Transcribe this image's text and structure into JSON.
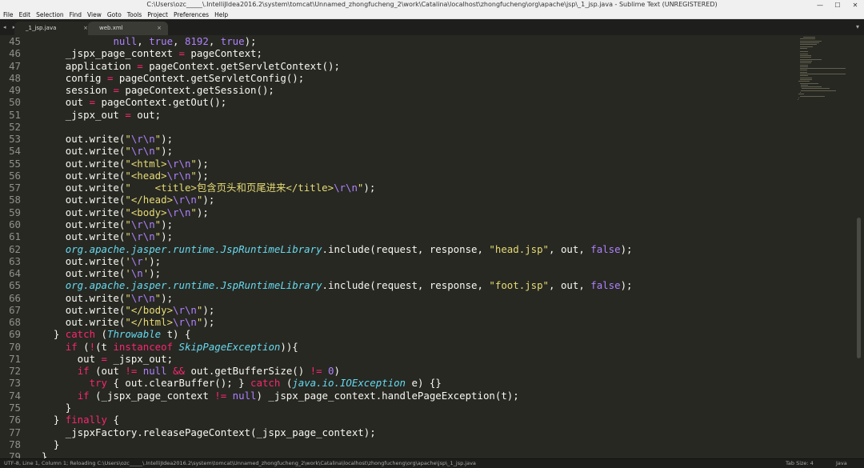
{
  "window": {
    "title": "C:\\Users\\ozc_____\\.IntelliJIdea2016.2\\system\\tomcat\\Unnamed_zhongfucheng_2\\work\\Catalina\\localhost\\zhongfucheng\\org\\apache\\jsp\\_1_jsp.java - Sublime Text (UNREGISTERED)",
    "minimize": "—",
    "maximize": "☐",
    "close": "✕"
  },
  "menu": [
    "File",
    "Edit",
    "Selection",
    "Find",
    "View",
    "Goto",
    "Tools",
    "Project",
    "Preferences",
    "Help"
  ],
  "tabs": {
    "nav": "◂ ▸",
    "items": [
      {
        "label": "_1_jsp.java",
        "close": "×",
        "active": true
      },
      {
        "label": "web.xml",
        "close": "×",
        "active": false
      }
    ],
    "dropdown": "▾"
  },
  "editor": {
    "lines": [
      {
        "n": 45,
        "t": [
          [
            "              ",
            "p"
          ],
          [
            "null",
            "c"
          ],
          [
            ", ",
            "p"
          ],
          [
            "true",
            "c"
          ],
          [
            ", ",
            "p"
          ],
          [
            "8192",
            "e"
          ],
          [
            ", ",
            "p"
          ],
          [
            "true",
            "c"
          ],
          [
            ");",
            "p"
          ]
        ]
      },
      {
        "n": 46,
        "t": [
          [
            "      _jspx_page_context ",
            "p"
          ],
          [
            "=",
            "k"
          ],
          [
            " pageContext;",
            "p"
          ]
        ]
      },
      {
        "n": 47,
        "t": [
          [
            "      application ",
            "p"
          ],
          [
            "=",
            "k"
          ],
          [
            " pageContext.getServletContext();",
            "p"
          ]
        ]
      },
      {
        "n": 48,
        "t": [
          [
            "      config ",
            "p"
          ],
          [
            "=",
            "k"
          ],
          [
            " pageContext.getServletConfig();",
            "p"
          ]
        ]
      },
      {
        "n": 49,
        "t": [
          [
            "      session ",
            "p"
          ],
          [
            "=",
            "k"
          ],
          [
            " pageContext.getSession();",
            "p"
          ]
        ]
      },
      {
        "n": 50,
        "t": [
          [
            "      out ",
            "p"
          ],
          [
            "=",
            "k"
          ],
          [
            " pageContext.getOut();",
            "p"
          ]
        ]
      },
      {
        "n": 51,
        "t": [
          [
            "      _jspx_out ",
            "p"
          ],
          [
            "=",
            "k"
          ],
          [
            " out;",
            "p"
          ]
        ]
      },
      {
        "n": 52,
        "t": []
      },
      {
        "n": 53,
        "t": [
          [
            "      out.write(",
            "p"
          ],
          [
            "\"",
            "s"
          ],
          [
            "\\r\\n",
            "e"
          ],
          [
            "\"",
            "s"
          ],
          [
            ");",
            "p"
          ]
        ]
      },
      {
        "n": 54,
        "t": [
          [
            "      out.write(",
            "p"
          ],
          [
            "\"",
            "s"
          ],
          [
            "\\r\\n",
            "e"
          ],
          [
            "\"",
            "s"
          ],
          [
            ");",
            "p"
          ]
        ]
      },
      {
        "n": 55,
        "t": [
          [
            "      out.write(",
            "p"
          ],
          [
            "\"<html>",
            "s"
          ],
          [
            "\\r\\n",
            "e"
          ],
          [
            "\"",
            "s"
          ],
          [
            ");",
            "p"
          ]
        ]
      },
      {
        "n": 56,
        "t": [
          [
            "      out.write(",
            "p"
          ],
          [
            "\"<head>",
            "s"
          ],
          [
            "\\r\\n",
            "e"
          ],
          [
            "\"",
            "s"
          ],
          [
            ");",
            "p"
          ]
        ]
      },
      {
        "n": 57,
        "t": [
          [
            "      out.write(",
            "p"
          ],
          [
            "\"    <title>包含页头和页尾进来</title>",
            "s"
          ],
          [
            "\\r\\n",
            "e"
          ],
          [
            "\"",
            "s"
          ],
          [
            ");",
            "p"
          ]
        ]
      },
      {
        "n": 58,
        "t": [
          [
            "      out.write(",
            "p"
          ],
          [
            "\"</head>",
            "s"
          ],
          [
            "\\r\\n",
            "e"
          ],
          [
            "\"",
            "s"
          ],
          [
            ");",
            "p"
          ]
        ]
      },
      {
        "n": 59,
        "t": [
          [
            "      out.write(",
            "p"
          ],
          [
            "\"<body>",
            "s"
          ],
          [
            "\\r\\n",
            "e"
          ],
          [
            "\"",
            "s"
          ],
          [
            ");",
            "p"
          ]
        ]
      },
      {
        "n": 60,
        "t": [
          [
            "      out.write(",
            "p"
          ],
          [
            "\"",
            "s"
          ],
          [
            "\\r\\n",
            "e"
          ],
          [
            "\"",
            "s"
          ],
          [
            ");",
            "p"
          ]
        ]
      },
      {
        "n": 61,
        "t": [
          [
            "      out.write(",
            "p"
          ],
          [
            "\"",
            "s"
          ],
          [
            "\\r\\n",
            "e"
          ],
          [
            "\"",
            "s"
          ],
          [
            ");",
            "p"
          ]
        ]
      },
      {
        "n": 62,
        "t": [
          [
            "      ",
            "p"
          ],
          [
            "org.apache.jasper.runtime.JspRuntimeLibrary",
            "i"
          ],
          [
            ".include(request, response, ",
            "p"
          ],
          [
            "\"head.jsp\"",
            "s"
          ],
          [
            ", out, ",
            "p"
          ],
          [
            "false",
            "c"
          ],
          [
            ");",
            "p"
          ]
        ]
      },
      {
        "n": 63,
        "t": [
          [
            "      out.write(",
            "p"
          ],
          [
            "'",
            "s"
          ],
          [
            "\\r",
            "e"
          ],
          [
            "'",
            "s"
          ],
          [
            ");",
            "p"
          ]
        ]
      },
      {
        "n": 64,
        "t": [
          [
            "      out.write(",
            "p"
          ],
          [
            "'",
            "s"
          ],
          [
            "\\n",
            "e"
          ],
          [
            "'",
            "s"
          ],
          [
            ");",
            "p"
          ]
        ]
      },
      {
        "n": 65,
        "t": [
          [
            "      ",
            "p"
          ],
          [
            "org.apache.jasper.runtime.JspRuntimeLibrary",
            "i"
          ],
          [
            ".include(request, response, ",
            "p"
          ],
          [
            "\"foot.jsp\"",
            "s"
          ],
          [
            ", out, ",
            "p"
          ],
          [
            "false",
            "c"
          ],
          [
            ");",
            "p"
          ]
        ]
      },
      {
        "n": 66,
        "t": [
          [
            "      out.write(",
            "p"
          ],
          [
            "\"",
            "s"
          ],
          [
            "\\r\\n",
            "e"
          ],
          [
            "\"",
            "s"
          ],
          [
            ");",
            "p"
          ]
        ]
      },
      {
        "n": 67,
        "t": [
          [
            "      out.write(",
            "p"
          ],
          [
            "\"</body>",
            "s"
          ],
          [
            "\\r\\n",
            "e"
          ],
          [
            "\"",
            "s"
          ],
          [
            ");",
            "p"
          ]
        ]
      },
      {
        "n": 68,
        "t": [
          [
            "      out.write(",
            "p"
          ],
          [
            "\"</html>",
            "s"
          ],
          [
            "\\r\\n",
            "e"
          ],
          [
            "\"",
            "s"
          ],
          [
            ");",
            "p"
          ]
        ]
      },
      {
        "n": 69,
        "t": [
          [
            "    } ",
            "p"
          ],
          [
            "catch",
            "k"
          ],
          [
            " (",
            "p"
          ],
          [
            "Throwable",
            "i"
          ],
          [
            " t) {",
            "p"
          ]
        ]
      },
      {
        "n": 70,
        "t": [
          [
            "      ",
            "p"
          ],
          [
            "if",
            "k"
          ],
          [
            " (",
            "p"
          ],
          [
            "!",
            "k"
          ],
          [
            "(t ",
            "p"
          ],
          [
            "instanceof",
            "k"
          ],
          [
            " ",
            "p"
          ],
          [
            "SkipPageException",
            "i"
          ],
          [
            ")){",
            "p"
          ]
        ]
      },
      {
        "n": 71,
        "t": [
          [
            "        out ",
            "p"
          ],
          [
            "=",
            "k"
          ],
          [
            " _jspx_out;",
            "p"
          ]
        ]
      },
      {
        "n": 72,
        "t": [
          [
            "        ",
            "p"
          ],
          [
            "if",
            "k"
          ],
          [
            " (out ",
            "p"
          ],
          [
            "!=",
            "k"
          ],
          [
            " ",
            "p"
          ],
          [
            "null",
            "c"
          ],
          [
            " ",
            "p"
          ],
          [
            "&&",
            "k"
          ],
          [
            " out.getBufferSize() ",
            "p"
          ],
          [
            "!=",
            "k"
          ],
          [
            " ",
            "p"
          ],
          [
            "0",
            "e"
          ],
          [
            ")",
            "p"
          ]
        ]
      },
      {
        "n": 73,
        "t": [
          [
            "          ",
            "p"
          ],
          [
            "try",
            "k"
          ],
          [
            " { out.clearBuffer(); } ",
            "p"
          ],
          [
            "catch",
            "k"
          ],
          [
            " (",
            "p"
          ],
          [
            "java.io.IOException",
            "i"
          ],
          [
            " e) {}",
            "p"
          ]
        ]
      },
      {
        "n": 74,
        "t": [
          [
            "        ",
            "p"
          ],
          [
            "if",
            "k"
          ],
          [
            " (_jspx_page_context ",
            "p"
          ],
          [
            "!=",
            "k"
          ],
          [
            " ",
            "p"
          ],
          [
            "null",
            "c"
          ],
          [
            ") _jspx_page_context.handlePageException(t);",
            "p"
          ]
        ]
      },
      {
        "n": 75,
        "t": [
          [
            "      }",
            "p"
          ]
        ]
      },
      {
        "n": 76,
        "t": [
          [
            "    } ",
            "p"
          ],
          [
            "finally",
            "k"
          ],
          [
            " {",
            "p"
          ]
        ]
      },
      {
        "n": 77,
        "t": [
          [
            "      _jspxFactory.releasePageContext(_jspx_page_context);",
            "p"
          ]
        ]
      },
      {
        "n": 78,
        "t": [
          [
            "    }",
            "p"
          ]
        ]
      },
      {
        "n": 79,
        "t": [
          [
            "  }",
            "p"
          ]
        ]
      }
    ]
  },
  "statusbar": {
    "text": "UTF-8, Line 1, Column 1; Reloading C:\\Users\\ozc_____\\.IntelliJIdea2016.2\\system\\tomcat\\Unnamed_zhongfucheng_2\\work\\Catalina\\localhost\\zhongfucheng\\org\\apache\\jsp\\_1_jsp.java",
    "tab_size": "Tab Size: 4",
    "syntax": "Java"
  },
  "colors": {
    "background": "#272822",
    "keyword": "#f92672",
    "string": "#e6db74",
    "constant": "#ae81ff",
    "type": "#66d9ef",
    "text": "#f8f8f2"
  }
}
